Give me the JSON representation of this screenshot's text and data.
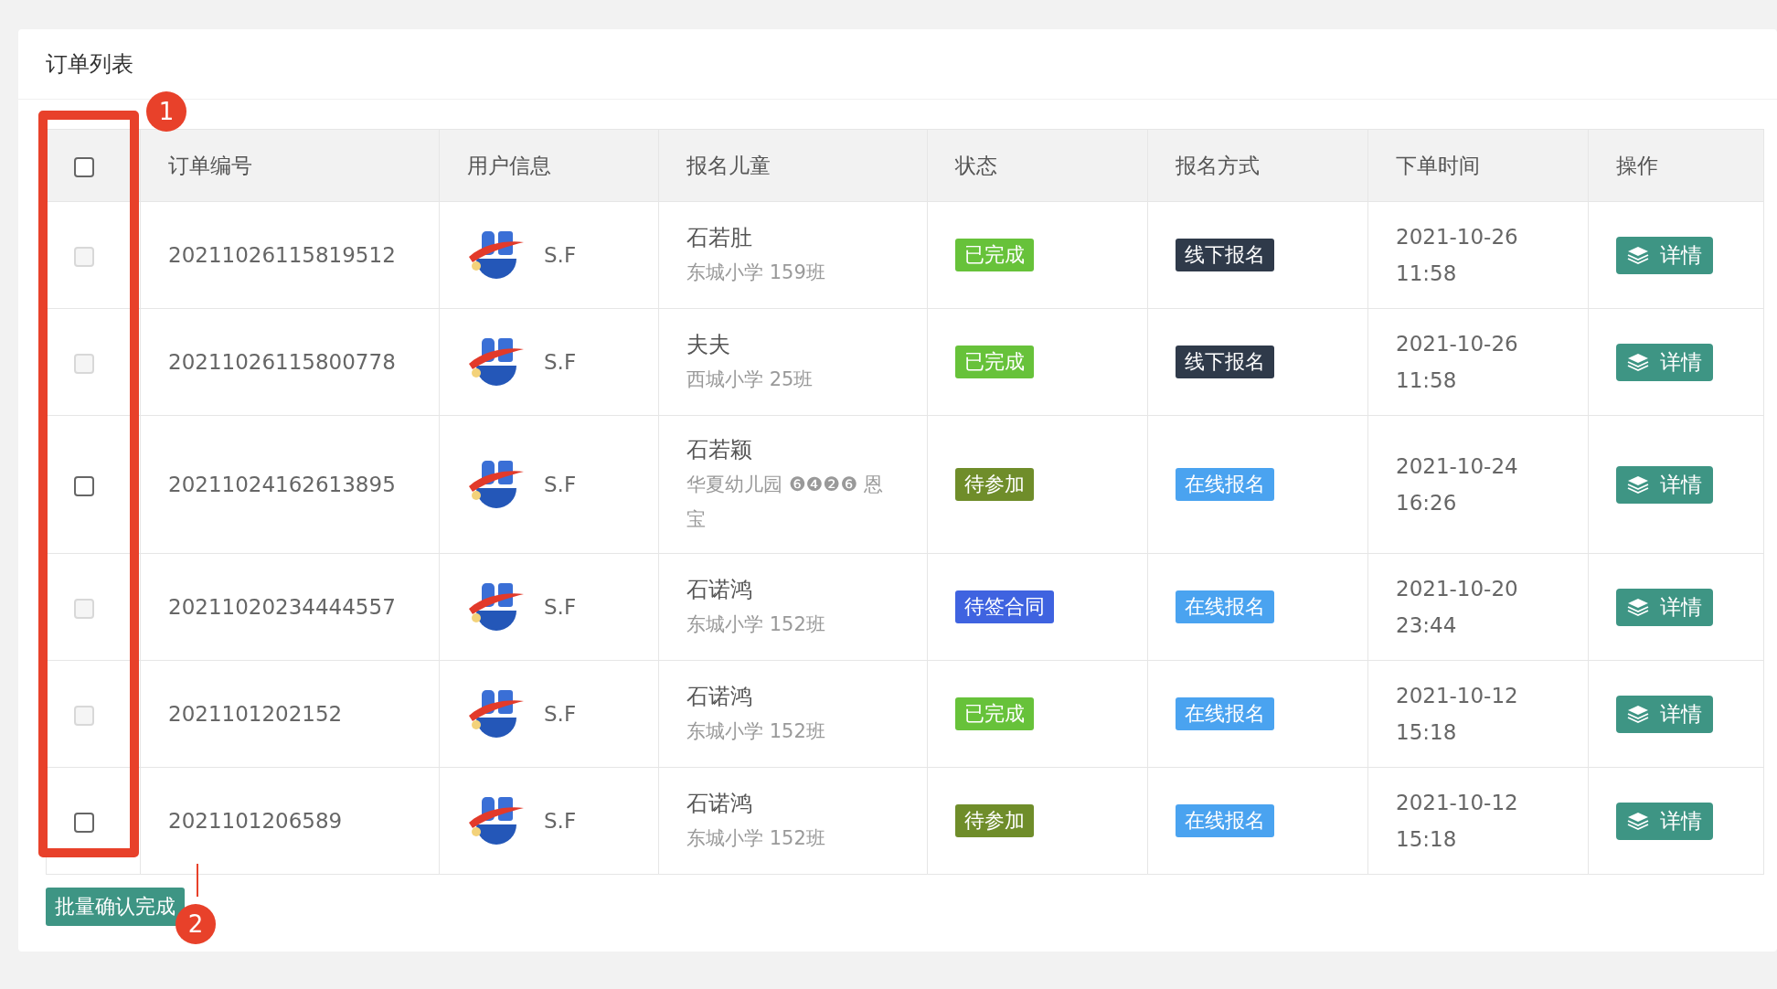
{
  "card": {
    "title": "订单列表"
  },
  "table": {
    "header_checkbox": {
      "checked": false,
      "disabled": false
    },
    "columns": [
      "订单编号",
      "用户信息",
      "报名儿童",
      "状态",
      "报名方式",
      "下单时间",
      "操作"
    ],
    "rows": [
      {
        "checked": false,
        "disabled": true,
        "order_no": "20211026115819512",
        "user": "S.F",
        "child_name": "石若肚",
        "child_school": "东城小学 159班",
        "status": {
          "label": "已完成",
          "color": "#67c23a"
        },
        "method": {
          "label": "线下报名",
          "color": "#2f3a4a"
        },
        "time": "2021-10-26 11:58",
        "action": "详情"
      },
      {
        "checked": false,
        "disabled": true,
        "order_no": "20211026115800778",
        "user": "S.F",
        "child_name": "夫夫",
        "child_school": "西城小学 25班",
        "status": {
          "label": "已完成",
          "color": "#67c23a"
        },
        "method": {
          "label": "线下报名",
          "color": "#2f3a4a"
        },
        "time": "2021-10-26 11:58",
        "action": "详情"
      },
      {
        "checked": false,
        "disabled": false,
        "order_no": "20211024162613895",
        "user": "S.F",
        "child_name": "石若颖",
        "child_school": "华夏幼儿园 ❻❹❷❻ 恩宝",
        "status": {
          "label": "待参加",
          "color": "#6f8d2a"
        },
        "method": {
          "label": "在线报名",
          "color": "#4aa3f0"
        },
        "time": "2021-10-24 16:26",
        "action": "详情"
      },
      {
        "checked": false,
        "disabled": true,
        "order_no": "20211020234444557",
        "user": "S.F",
        "child_name": "石诺鸿",
        "child_school": "东城小学 152班",
        "status": {
          "label": "待签合同",
          "color": "#3f63e0"
        },
        "method": {
          "label": "在线报名",
          "color": "#4aa3f0"
        },
        "time": "2021-10-20 23:44",
        "action": "详情"
      },
      {
        "checked": false,
        "disabled": true,
        "order_no": "2021101202152",
        "user": "S.F",
        "child_name": "石诺鸿",
        "child_school": "东城小学 152班",
        "status": {
          "label": "已完成",
          "color": "#67c23a"
        },
        "method": {
          "label": "在线报名",
          "color": "#4aa3f0"
        },
        "time": "2021-10-12 15:18",
        "action": "详情"
      },
      {
        "checked": false,
        "disabled": false,
        "order_no": "2021101206589",
        "user": "S.F",
        "child_name": "石诺鸿",
        "child_school": "东城小学 152班",
        "status": {
          "label": "待参加",
          "color": "#6f8d2a"
        },
        "method": {
          "label": "在线报名",
          "color": "#4aa3f0"
        },
        "time": "2021-10-12 15:18",
        "action": "详情"
      }
    ]
  },
  "batch_button": "批量确认完成",
  "annotations": [
    "1",
    "2"
  ]
}
